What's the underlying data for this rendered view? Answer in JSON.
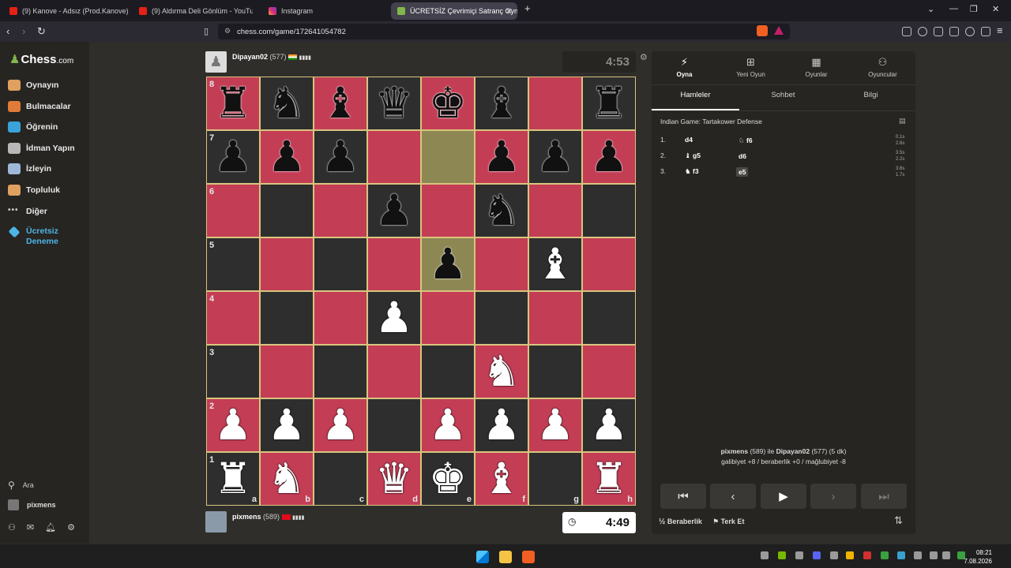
{
  "browser": {
    "tabs": [
      {
        "label": "(9) Kanove - Adsız (Prod.Kanove) - Yo",
        "favicon": "youtube-icon",
        "active": false
      },
      {
        "label": "(9) Aldırma Deli Gönlüm - YouTub",
        "favicon": "youtube-icon",
        "active": false
      },
      {
        "label": "Instagram",
        "favicon": "instagram-icon",
        "active": false
      },
      {
        "label": "ÜCRETSİZ Çevrimiçi Satranç Oyn",
        "favicon": "chess-icon",
        "active": true
      }
    ],
    "new_tab": "+",
    "url": "chess.com/game/172641054782"
  },
  "sidebar": {
    "logo_main": "Chess",
    "logo_suffix": ".com",
    "items": [
      {
        "label": "Oynayın",
        "icon": "play-icon",
        "color": "#e0a060"
      },
      {
        "label": "Bulmacalar",
        "icon": "puzzle-icon",
        "color": "#e07b39"
      },
      {
        "label": "Öğrenin",
        "icon": "learn-icon",
        "color": "#3aa3d9"
      },
      {
        "label": "İdman Yapın",
        "icon": "train-icon",
        "color": "#b8b8b8"
      },
      {
        "label": "İzleyin",
        "icon": "watch-icon",
        "color": "#9fb8d8"
      },
      {
        "label": "Topluluk",
        "icon": "community-icon",
        "color": "#e0a060"
      },
      {
        "label": "Diğer",
        "icon": "more-icon",
        "color": "#cccccc"
      }
    ],
    "trial_line1": "Ücretsiz",
    "trial_line2": "Deneme",
    "search": "Ara",
    "username": "pixmens"
  },
  "game": {
    "top_player": {
      "name": "Dipayan02",
      "rating": "(577)",
      "flag": "IN"
    },
    "top_clock": "4:53",
    "bottom_player": {
      "name": "pixmens",
      "rating": "(589)",
      "flag": "TR"
    },
    "bottom_clock": "4:49",
    "colors": {
      "light": "#c33d55",
      "dark": "#2e2e2e",
      "highlight": "#8d8753",
      "border": "#e9d48c"
    },
    "ranks": [
      "8",
      "7",
      "6",
      "5",
      "4",
      "3",
      "2",
      "1"
    ],
    "files": [
      "a",
      "b",
      "c",
      "d",
      "e",
      "f",
      "g",
      "h"
    ],
    "position": [
      [
        "bR",
        "bN",
        "bB",
        "bQ",
        "bK",
        "bB",
        "",
        "bR"
      ],
      [
        "bP",
        "bP",
        "bP",
        "",
        "",
        "bP",
        "bP",
        "bP"
      ],
      [
        "",
        "",
        "",
        "bP",
        "",
        "bN",
        "",
        ""
      ],
      [
        "",
        "",
        "",
        "",
        "bP",
        "",
        "wB",
        ""
      ],
      [
        "",
        "",
        "",
        "wP",
        "",
        "",
        "",
        ""
      ],
      [
        "",
        "",
        "",
        "",
        "",
        "wN",
        "",
        ""
      ],
      [
        "wP",
        "wP",
        "wP",
        "",
        "wP",
        "wP",
        "wP",
        "wP"
      ],
      [
        "wR",
        "wN",
        "",
        "wQ",
        "wK",
        "wB",
        "",
        "wR"
      ]
    ],
    "highlighted": [
      "e7",
      "e5"
    ]
  },
  "panel": {
    "top_tabs": [
      {
        "label": "Oyna",
        "icon": "lightning-icon"
      },
      {
        "label": "Yeni Oyun",
        "icon": "plus-icon"
      },
      {
        "label": "Oyunlar",
        "icon": "board-icon"
      },
      {
        "label": "Oyuncular",
        "icon": "players-icon"
      }
    ],
    "sub_tabs": [
      "Hamleler",
      "Sohbet",
      "Bilgi"
    ],
    "opening": "Indian Game: Tartakower Defense",
    "moves": [
      {
        "num": "1.",
        "white": "d4",
        "white_piece": "",
        "black": "f6",
        "black_piece": "♘",
        "times": [
          "0.1s",
          "2.6s"
        ]
      },
      {
        "num": "2.",
        "white": "g5",
        "white_piece": "♝",
        "black": "d6",
        "black_piece": "",
        "times": [
          "3.5s",
          "2.2s"
        ]
      },
      {
        "num": "3.",
        "white": "f3",
        "white_piece": "♞",
        "black": "e5",
        "black_piece": "",
        "times": [
          "3.6s",
          "1.7s"
        ]
      }
    ],
    "summary_white": "pixmens",
    "summary_white_rating": "(589)",
    "summary_vs": "ile",
    "summary_black": "Dipayan02",
    "summary_black_rating": "(577) (5 dk)",
    "summary_line2": "galibiyet +8 / beraberlik +0 / mağlubiyet -8",
    "draw": "Beraberlik",
    "resign": "Terk Et"
  },
  "taskbar": {
    "time": "08:21",
    "date": "7.08.2026"
  }
}
